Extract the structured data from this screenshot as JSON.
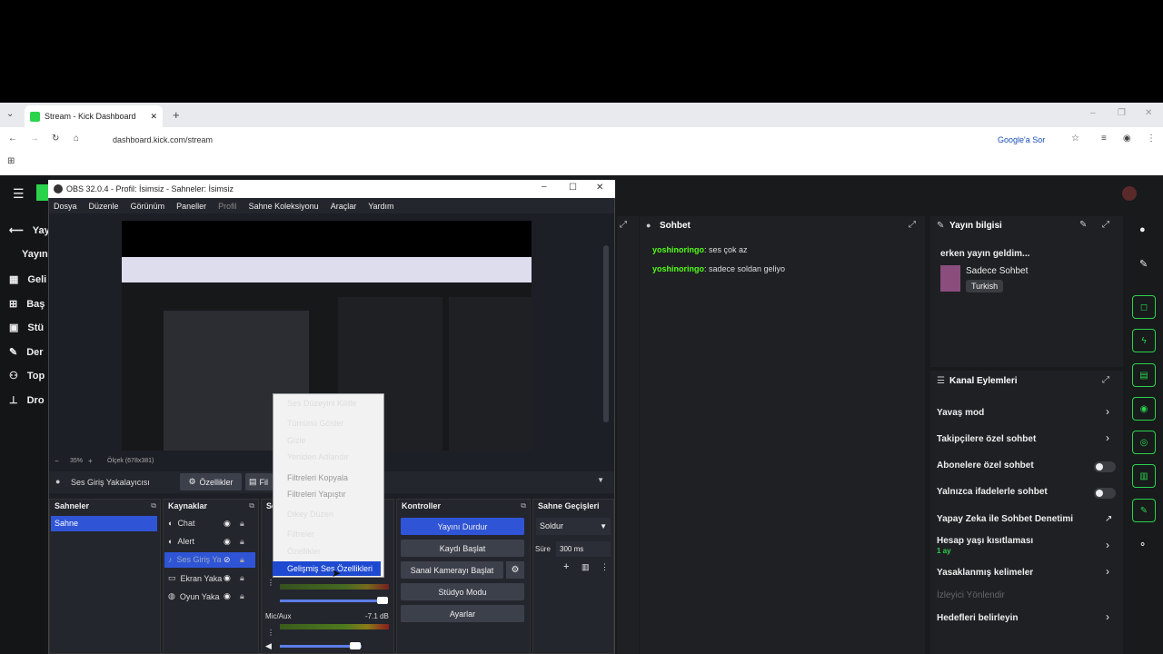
{
  "browser": {
    "tab_title": "Stream - Kick Dashboard",
    "url": "dashboard.kick.com/stream",
    "ask_google": "Google'a Sor"
  },
  "nav": {
    "items": [
      "Yay",
      "Yayın",
      "Geli",
      "Baş",
      "Stü",
      "Der",
      "Top",
      "Dro"
    ]
  },
  "chat": {
    "title": "Sohbet",
    "messages": [
      {
        "user": "yoshinoringo",
        "text": ": ses çok az"
      },
      {
        "user": "yoshinoringo",
        "text": ": sadece soldan geliyo"
      }
    ]
  },
  "stream_info": {
    "title": "Yayın bilgisi",
    "stream_title": "erken yayın geldim...",
    "category": "Sadece Sohbet",
    "language": "Turkish"
  },
  "channel_actions": {
    "title": "Kanal Eylemleri",
    "slow_mode": "Yavaş mod",
    "followers_only": "Takipçilere özel sohbet",
    "subscribers_only": "Abonelere özel sohbet",
    "emotes_only": "Yalnızca ifadelerle sohbet",
    "ai_moderation": "Yapay Zeka ile Sohbet Denetimi",
    "account_age": "Hesap yaşı kısıtlaması",
    "account_age_value": "1 ay",
    "banned_words": "Yasaklanmış kelimeler",
    "viewer_redirect": "İzleyici Yönlendir",
    "goals": "Hedefleri belirleyin"
  },
  "obs": {
    "title": "OBS 32.0.4 - Profil: İsimsiz - Sahneler: İsimsiz",
    "menu": [
      "Dosya",
      "Düzenle",
      "Görünüm",
      "Paneller",
      "Profil",
      "Sahne Koleksiyonu",
      "Araçlar",
      "Yardım"
    ],
    "zoom": "35%",
    "scale": "Ölçek (678x381)",
    "source_bar_label": "Ses Giriş Yakalayıcısı",
    "props_btn": "Özellikler",
    "filters_btn": "Fil",
    "scenes_title": "Sahneler",
    "scene": "Sahne",
    "sources_title": "Kaynaklar",
    "sources": [
      "Chat",
      "Alert",
      "Ses Giriş Ya",
      "Ekran Yaka",
      "Oyun Yaka"
    ],
    "controls_title": "Kontroller",
    "stop_stream": "Yayını Durdur",
    "start_rec": "Kaydı Başlat",
    "virtual_cam": "Sanal Kamerayı Başlat",
    "studio": "Stüdyo Modu",
    "settings": "Ayarlar",
    "transitions_title": "Sahne Geçişleri",
    "transition": "Soldur",
    "duration_label": "Süre",
    "duration": "300 ms",
    "mic_label": "Mic/Aux",
    "mic_db": "-7.1 dB",
    "mixer_prefix": "Se"
  },
  "context_menu": [
    "Ses Düzeyini Kilitle",
    "Tümünü Göster",
    "Gizle",
    "Yeniden Adlandır",
    "Filtreleri Kopyala",
    "Filtreleri Yapıştır",
    "Dikey Düzen",
    "Filtreler",
    "Özellikler",
    "Gelişmiş Ses Özellikleri"
  ]
}
